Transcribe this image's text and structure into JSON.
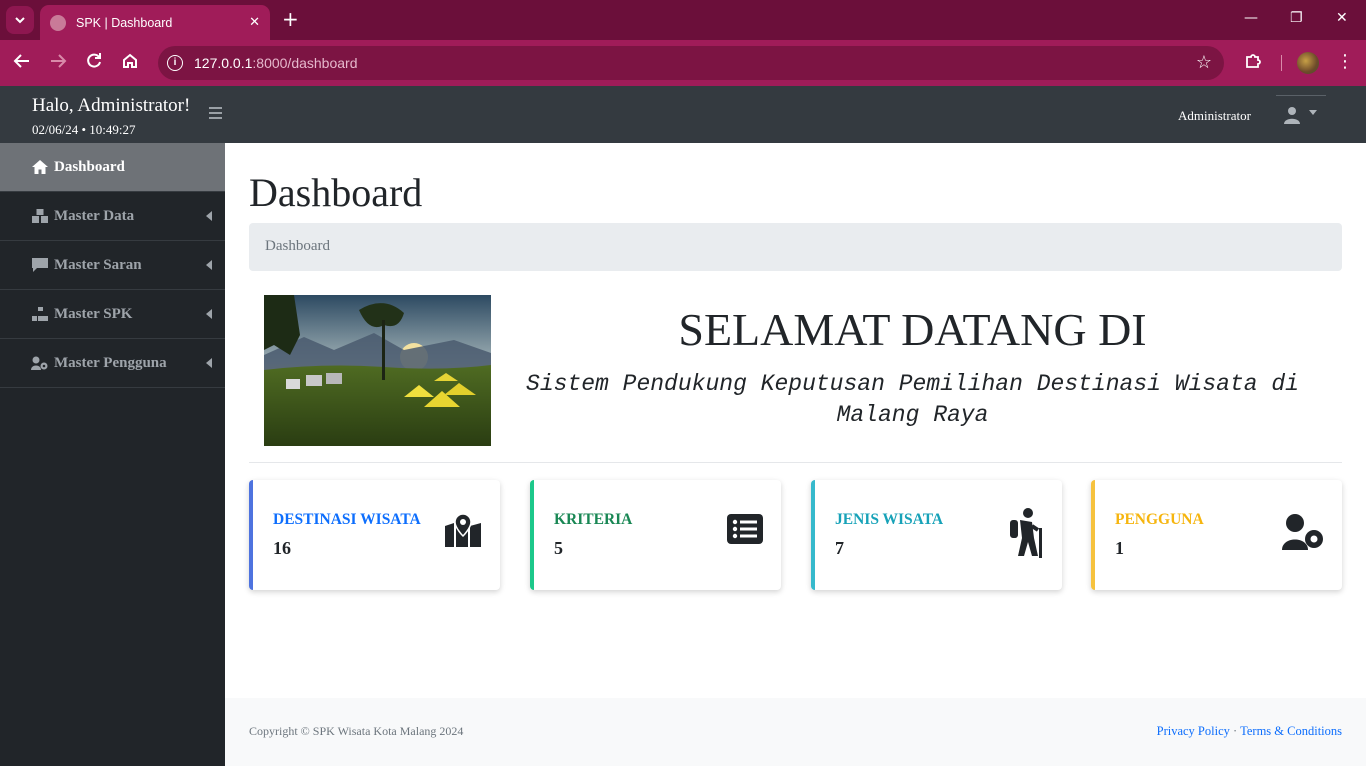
{
  "browser": {
    "tab_title": "SPK | Dashboard",
    "tab_close": "✕",
    "new_tab": "+",
    "url_host": "127.0.0.1",
    "url_path": ":8000/dashboard",
    "win_minimize": "—",
    "win_restore": "❐",
    "win_close": "✕"
  },
  "topnav": {
    "greeting": "Halo, Administrator!",
    "datetime": "02/06/24 • 10:49:27",
    "user_name": "Administrator"
  },
  "sidebar": {
    "items": [
      {
        "label": "Dashboard",
        "icon": "home-icon",
        "active": true
      },
      {
        "label": "Master Data",
        "icon": "cubes-icon"
      },
      {
        "label": "Master Saran",
        "icon": "comment-icon"
      },
      {
        "label": "Master SPK",
        "icon": "sitemap-icon"
      },
      {
        "label": "Master Pengguna",
        "icon": "users-cog-icon"
      }
    ]
  },
  "main": {
    "title": "Dashboard",
    "breadcrumb": "Dashboard",
    "hero_title": "SELAMAT DATANG DI",
    "hero_subtitle": "Sistem Pendukung Keputusan Pemilihan Destinasi Wisata di Malang Raya"
  },
  "cards": [
    {
      "label": "DESTINASI WISATA",
      "value": "16",
      "color": "#0d6efd",
      "border": "#4e73df",
      "icon": "map-marked-icon"
    },
    {
      "label": "KRITERIA",
      "value": "5",
      "color": "#198754",
      "border": "#1cc88a",
      "icon": "list-icon"
    },
    {
      "label": "JENIS WISATA",
      "value": "7",
      "color": "#17a2b8",
      "border": "#36b9cc",
      "icon": "hiking-icon"
    },
    {
      "label": "PENGGUNA",
      "value": "1",
      "color": "#f6b50e",
      "border": "#f6c23e",
      "icon": "user-cog-icon"
    }
  ],
  "footer": {
    "copyright": "Copyright © SPK Wisata Kota Malang 2024",
    "privacy": "Privacy Policy",
    "separator": "·",
    "terms": "Terms & Conditions"
  }
}
